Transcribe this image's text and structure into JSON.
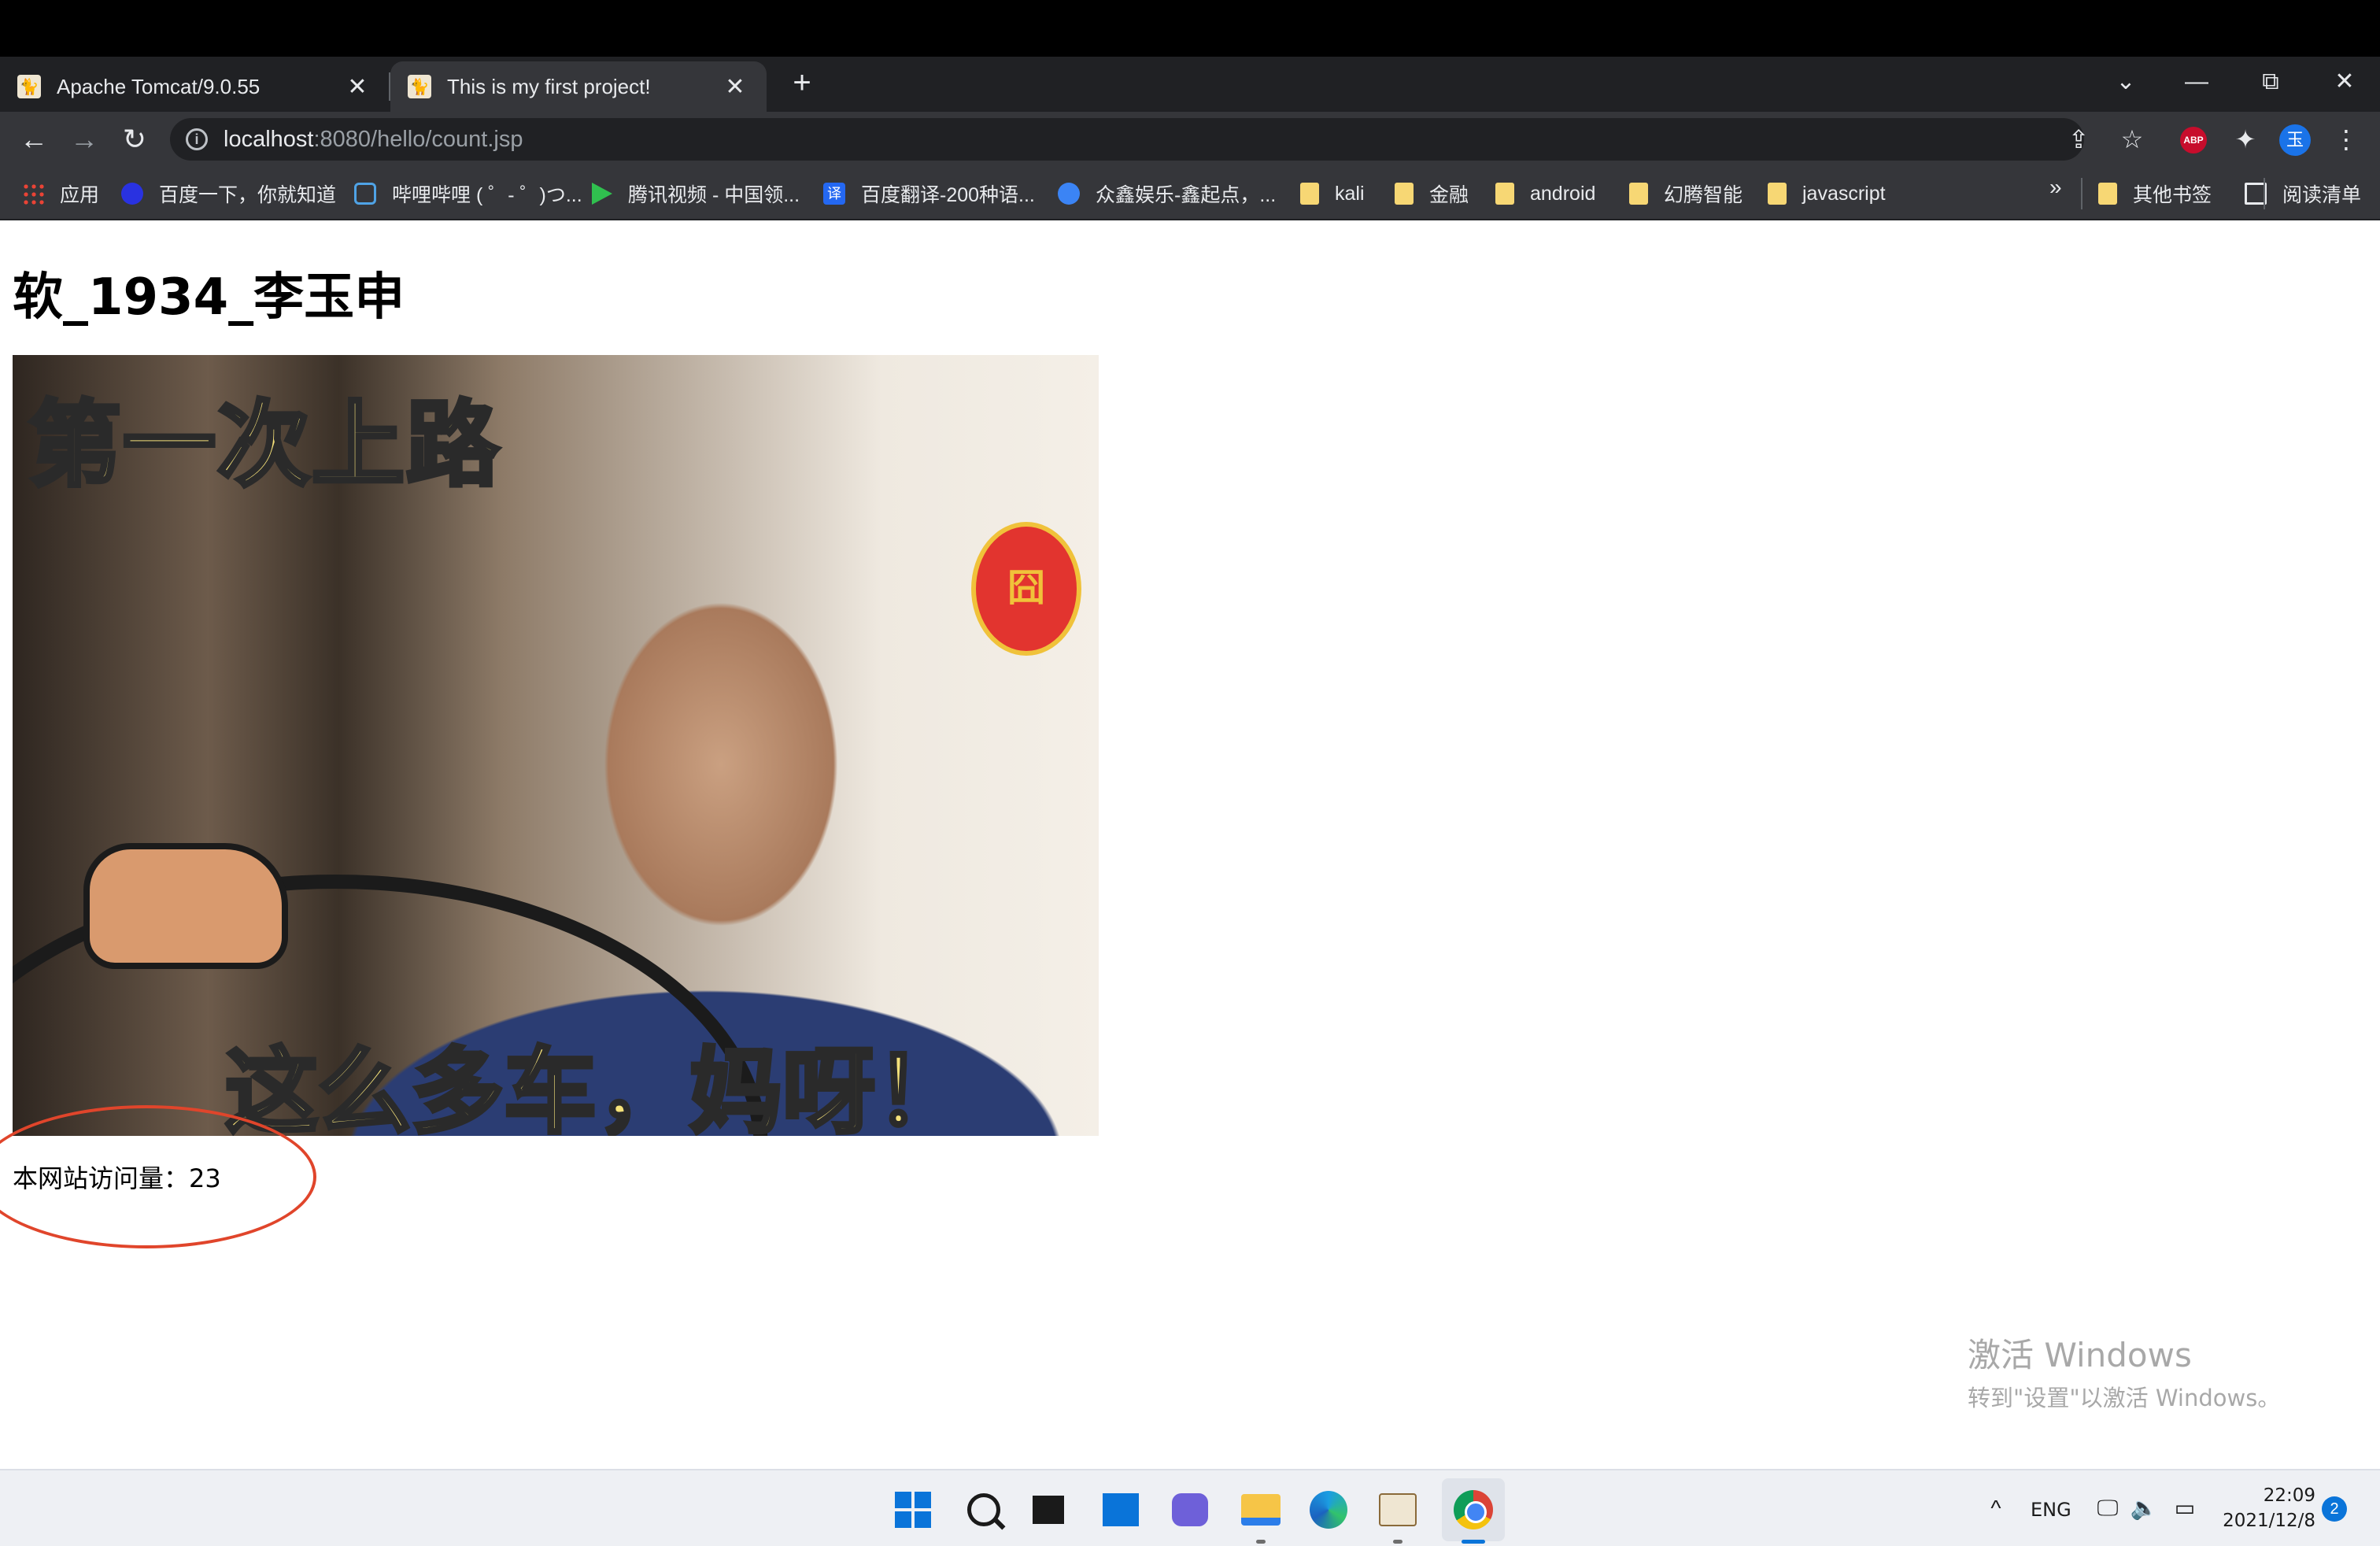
{
  "browser": {
    "tabs": [
      {
        "title": "Apache Tomcat/9.0.55",
        "close": "✕"
      },
      {
        "title": "This is my first project!",
        "close": "✕"
      }
    ],
    "new_tab": "+",
    "window_controls": {
      "tab_search": "⌄",
      "minimize": "—",
      "restore": "⧉",
      "close": "✕"
    },
    "nav": {
      "back": "←",
      "forward": "→",
      "reload": "↻"
    },
    "address": {
      "info_icon": "i",
      "host": "localhost",
      "path": ":8080/hello/count.jsp"
    },
    "toolbar_icons": {
      "share": "⇪",
      "star": "☆",
      "adblock": "ABP",
      "extensions": "✦",
      "profile": "玉",
      "menu": "⋮"
    },
    "bookmarks": [
      {
        "label": "应用",
        "icon": "apps-icon"
      },
      {
        "label": "百度一下，你就知道",
        "icon": "baidu-icon"
      },
      {
        "label": "哔哩哔哩 ( ゜- ゜)つ...",
        "icon": "bilibili-icon"
      },
      {
        "label": "腾讯视频 - 中国领...",
        "icon": "tencent-video-icon"
      },
      {
        "label": "百度翻译-200种语...",
        "icon": "baidu-fanyi-icon",
        "glyph": "译"
      },
      {
        "label": "众鑫娱乐-鑫起点，...",
        "icon": "zhongxin-icon"
      },
      {
        "label": "kali",
        "icon": "folder-icon"
      },
      {
        "label": "金融",
        "icon": "folder-icon"
      },
      {
        "label": "android",
        "icon": "folder-icon"
      },
      {
        "label": "幻腾智能",
        "icon": "folder-icon"
      },
      {
        "label": "javascript",
        "icon": "folder-icon"
      }
    ],
    "bookmarks_more": "»",
    "other_bookmarks": "其他书签",
    "reading_list": "阅读清单"
  },
  "page": {
    "heading": "软_1934_李玉申",
    "meme": {
      "top_text": "第一次上路",
      "bottom_text": "这么多车，妈呀！",
      "seal_text": "囧"
    },
    "counter_label": "本网站访问量：",
    "counter_value": "23"
  },
  "watermark": {
    "line1": "激活 Windows",
    "line2": "转到\"设置\"以激活 Windows。"
  },
  "taskbar": {
    "apps": [
      "start-icon",
      "search-icon",
      "task-view-icon",
      "widgets-icon",
      "chat-icon",
      "file-explorer-icon",
      "edge-icon",
      "tomcat-icon",
      "chrome-icon"
    ],
    "tray": {
      "chevron": "^",
      "language": "ENG",
      "network": "🖵",
      "volume": "🔈",
      "battery": "▭"
    },
    "time": "22:09",
    "date": "2021/12/8",
    "notifications": "2"
  },
  "colors": {
    "annotation_circle": "#e0452b",
    "taskbar_accent": "#0a74d9"
  }
}
